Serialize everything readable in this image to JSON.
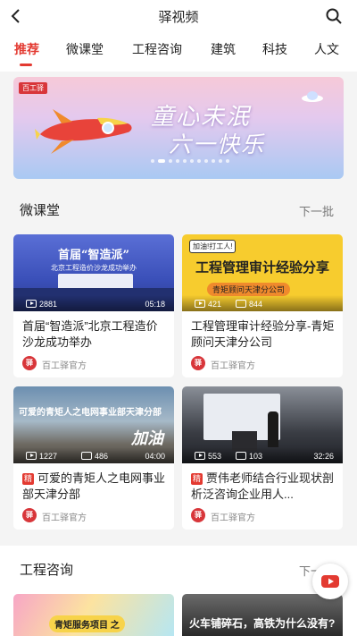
{
  "header": {
    "title": "驿视频",
    "back_icon": "chevron-left-icon",
    "search_icon": "search-icon"
  },
  "tabs": [
    {
      "label": "推荐",
      "active": true
    },
    {
      "label": "微课堂",
      "active": false
    },
    {
      "label": "工程咨询",
      "active": false
    },
    {
      "label": "建筑",
      "active": false
    },
    {
      "label": "科技",
      "active": false
    },
    {
      "label": "人文",
      "active": false
    }
  ],
  "banner": {
    "badge": "百工驿",
    "line1": "童心未泯",
    "line2": "六一快乐",
    "slide_count": 12,
    "active_slide": 1
  },
  "sections": {
    "micro_class": {
      "title": "微课堂",
      "more": "下一批"
    },
    "engineering": {
      "title": "工程咨询",
      "more": "下一批"
    }
  },
  "cards": [
    {
      "thumb_title": "首届“智造派”",
      "thumb_sub": "北京工程造价沙龙成功举办",
      "views": "2881",
      "danmu": "",
      "duration": "05:18",
      "featured": false,
      "title": "首届“智造派”北京工程造价沙龙成功举办",
      "author": "百工驿官方"
    },
    {
      "thumb_title": "工程管理审计经验分享",
      "thumb_sub": "青矩顾问天津分公司",
      "thumb_tag": "加油!打工人!",
      "views": "421",
      "danmu": "844",
      "duration": "",
      "featured": false,
      "title": "工程管理审计经验分享-青矩顾问天津分公司",
      "author": "百工驿官方"
    },
    {
      "thumb_title": "可爱的青矩人之电网事业部天津分部",
      "thumb_sub": "加油",
      "views": "1227",
      "danmu": "486",
      "duration": "04:00",
      "featured": true,
      "title": "可爱的青矩人之电网事业部天津分部",
      "author": "百工驿官方"
    },
    {
      "thumb_title": "",
      "thumb_sub": "",
      "views": "553",
      "danmu": "103",
      "duration": "32:26",
      "featured": true,
      "title": "贾伟老师结合行业现状剖析泛咨询企业用人...",
      "author": "百工驿官方"
    }
  ],
  "featured_tag": "精",
  "author_logo": "驿",
  "peek": {
    "left_caption": "青矩服务项目 之",
    "right_caption": "火车铺碎石，高铁为什么没有?"
  },
  "colors": {
    "accent": "#e33a31",
    "background": "#f4f4f4"
  },
  "fab_icon": "video-play-icon"
}
